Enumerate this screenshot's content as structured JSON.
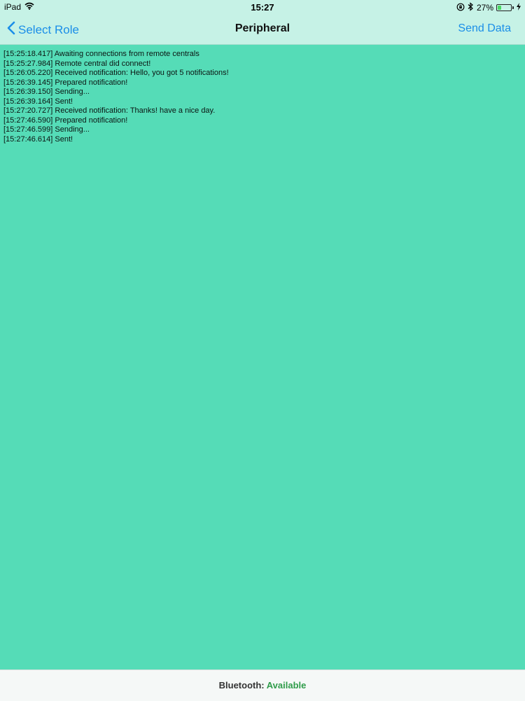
{
  "status_bar": {
    "device": "iPad",
    "time": "15:27",
    "battery_text": "27%",
    "battery_level": 0.27,
    "icons": [
      "wifi-icon",
      "orientation-lock-icon",
      "bluetooth-icon",
      "battery-icon",
      "charging-icon"
    ]
  },
  "nav": {
    "back_label": "Select Role",
    "title": "Peripheral",
    "action_label": "Send Data"
  },
  "log": {
    "entries": [
      "[15:25:18.417] Awaiting connections from remote centrals",
      "[15:25:27.984] Remote central did connect!",
      "[15:26:05.220] Received notification: Hello, you got 5 notifications!",
      "[15:26:39.145] Prepared notification!",
      "[15:26:39.150] Sending...",
      "[15:26:39.164] Sent!",
      "[15:27:20.727] Received notification: Thanks! have a nice day.",
      "[15:27:46.590] Prepared notification!",
      "[15:27:46.599] Sending...",
      "[15:27:46.614] Sent!"
    ]
  },
  "footer": {
    "label": "Bluetooth:",
    "value": "Available"
  },
  "colors": {
    "background": "#55dcb7",
    "nav_background": "#c6f2e6",
    "accent": "#1a8ee8",
    "available": "#2f9c4a"
  }
}
